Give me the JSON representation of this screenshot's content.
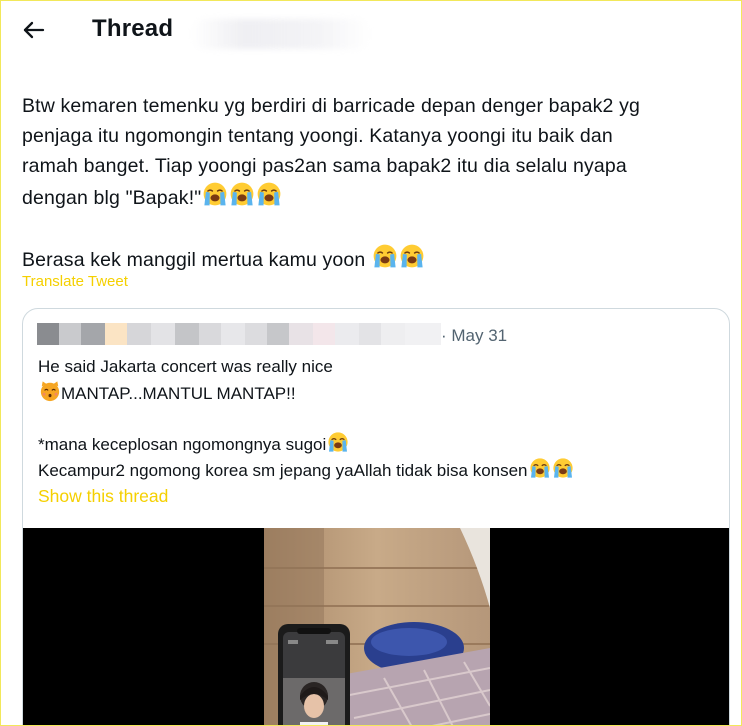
{
  "header": {
    "title": "Thread",
    "back_icon": "arrow-left-icon"
  },
  "tweet": {
    "lines": [
      "Btw kemaren temenku yg berdiri di barricade depan denger bapak2 yg",
      "penjaga itu ngomongin tentang yoongi. Katanya yoongi itu baik dan",
      "ramah banget. Tiap yoongi pas2an sama bapak2 itu dia selalu nyapa",
      "dengan blg \"Bapak!\""
    ],
    "line2": "Berasa kek manggil mertua kamu yoon",
    "emoji": "loudly-crying-face",
    "translate_label": "Translate Tweet"
  },
  "quote": {
    "date": "· May 31",
    "line1": "He said Jakarta concert was really nice",
    "line2": "MANTAP...MANTUL MANTAP!!",
    "line2_emoji": "kissing-cat-face",
    "line3": "*mana keceplosan ngomongnya sugoi",
    "line4": "Kecampur2 ngomong korea sm jepang yaAllah tidak bisa konsen",
    "show_thread": "Show this thread"
  },
  "colors": {
    "accent": "#f5d000",
    "text": "#0f1419",
    "muted": "#536471",
    "border": "#cfd9de"
  }
}
